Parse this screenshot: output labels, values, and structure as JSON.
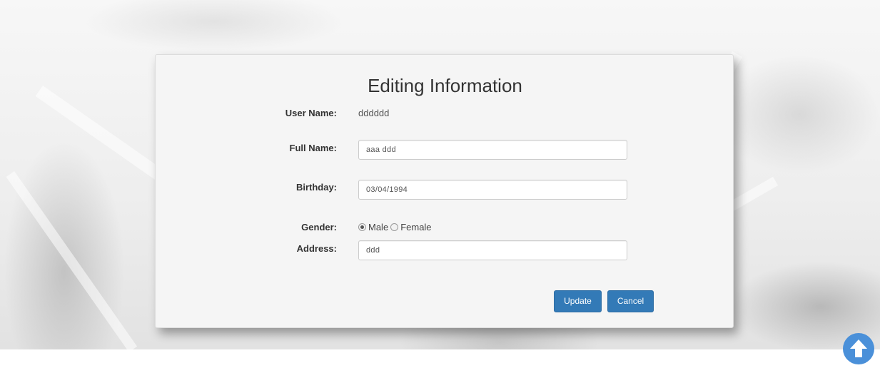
{
  "form": {
    "title": "Editing Information",
    "username_label": "User Name:",
    "username_value": "dddddd",
    "fullname_label": "Full Name:",
    "fullname_value": "aaa ddd",
    "birthday_label": "Birthday:",
    "birthday_value": "03/04/1994",
    "gender_label": "Gender:",
    "gender_options": [
      "Male",
      "Female"
    ],
    "gender_selected": "Male",
    "address_label": "Address:",
    "address_value": "ddd",
    "update_label": "Update",
    "cancel_label": "Cancel"
  },
  "scroll_top": {
    "icon": "arrow-up-icon",
    "color": "#4a90d9"
  },
  "colors": {
    "primary": "#337ab7",
    "panel": "#f5f5f5"
  }
}
